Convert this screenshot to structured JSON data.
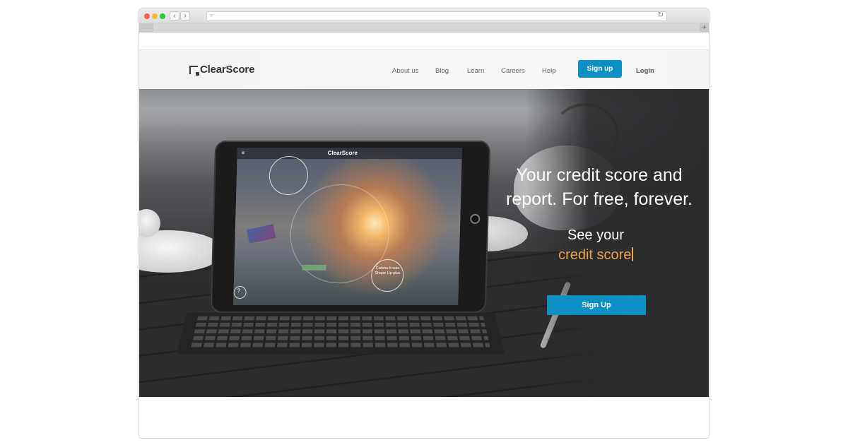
{
  "browser": {
    "back_label": "‹",
    "forward_label": "›",
    "search_icon": "⌕",
    "reload_icon": "↻",
    "new_tab_label": "+"
  },
  "site": {
    "logo_text": "ClearScore",
    "nav": {
      "about": "About us",
      "blog": "Blog",
      "learn": "Learn",
      "careers": "Careers",
      "help": "Help"
    },
    "signup_label": "Sign up",
    "login_label": "Login"
  },
  "hero": {
    "title": "Your credit score and report. For free, forever.",
    "subtitle": "See your",
    "rotating_text": "credit score",
    "cta_label": "Sign Up"
  },
  "tablet_screen": {
    "logo_text": "ClearScore",
    "menu_icon": "≡",
    "help_icon": "?",
    "prompt_text": "Cahmu lt was Shape Up plus"
  },
  "colors": {
    "brand_blue": "#0c8fc4",
    "accent_orange": "#f0a24d"
  }
}
